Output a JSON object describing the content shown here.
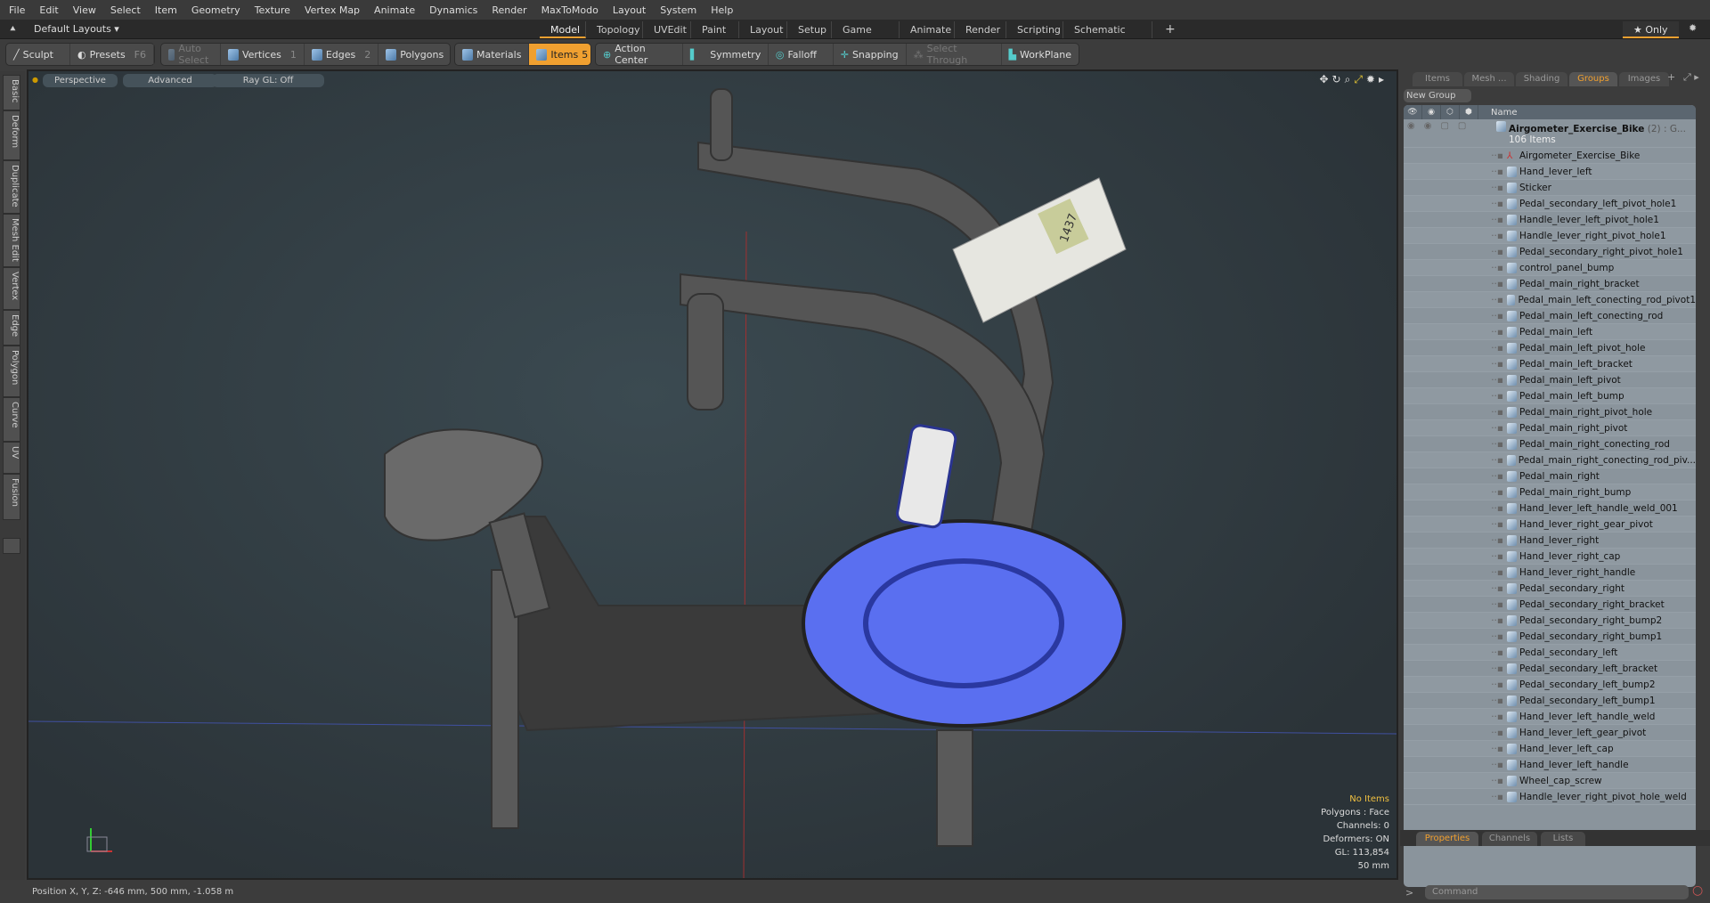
{
  "menu": [
    "File",
    "Edit",
    "View",
    "Select",
    "Item",
    "Geometry",
    "Texture",
    "Vertex Map",
    "Animate",
    "Dynamics",
    "Render",
    "MaxToModo",
    "Layout",
    "System",
    "Help"
  ],
  "layouts": {
    "selector": "Default Layouts ▾",
    "tabs": [
      "Model",
      "Topology",
      "UVEdit",
      "Paint",
      "Layout",
      "Setup",
      "Game Tools",
      "Animate",
      "Render",
      "Scripting",
      "Schematic Fusion"
    ],
    "active": "Model",
    "add": "+",
    "only": "★ Only"
  },
  "toolbar": {
    "sculpt": "Sculpt",
    "presets": "Presets",
    "presets_key": "F6",
    "auto_select": "Auto Select",
    "vertices": "Vertices",
    "vertices_key": "1",
    "edges": "Edges",
    "edges_key": "2",
    "polygons": "Polygons",
    "materials": "Materials",
    "items": "Items",
    "items_key": "5",
    "action_center": "Action Center",
    "symmetry": "Symmetry",
    "falloff": "Falloff",
    "snapping": "Snapping",
    "select_through": "Select Through",
    "workplane": "WorkPlane"
  },
  "left_tabs": [
    "Basic",
    "Deform",
    "Duplicate",
    "Mesh Edit",
    "Vertex",
    "Edge",
    "Polygon",
    "Curve",
    "UV",
    "Fusion"
  ],
  "viewport": {
    "view": "Perspective",
    "shading": "Advanced",
    "raygl": "Ray GL: Off",
    "display_value": "1437",
    "info": {
      "selection": "No Items",
      "mode": "Polygons : Face",
      "channels": "Channels: 0",
      "deformers": "Deformers: ON",
      "gl": "GL: 113,854",
      "scale": "50 mm"
    }
  },
  "status": "Position X, Y, Z:   -646 mm, 500 mm, -1.058 m",
  "right_panel": {
    "tabs": [
      "Items",
      "Mesh ...",
      "Shading",
      "Groups",
      "Images"
    ],
    "active": "Groups",
    "new_group": "New Group",
    "name_header": "Name",
    "group": {
      "name": "Airgometer_Exercise_Bike",
      "suffix": " (2) : G...",
      "count": "106 Items"
    },
    "items": [
      "Airgometer_Exercise_Bike",
      "Hand_lever_left",
      "Sticker",
      "Pedal_secondary_left_pivot_hole1",
      "Handle_lever_left_pivot_hole1",
      "Handle_lever_right_pivot_hole1",
      "Pedal_secondary_right_pivot_hole1",
      "control_panel_bump",
      "Pedal_main_right_bracket",
      "Pedal_main_left_conecting_rod_pivot1",
      "Pedal_main_left_conecting_rod",
      "Pedal_main_left",
      "Pedal_main_left_pivot_hole",
      "Pedal_main_left_bracket",
      "Pedal_main_left_pivot",
      "Pedal_main_left_bump",
      "Pedal_main_right_pivot_hole",
      "Pedal_main_right_pivot",
      "Pedal_main_right_conecting_rod",
      "Pedal_main_right_conecting_rod_piv...",
      "Pedal_main_right",
      "Pedal_main_right_bump",
      "Hand_lever_left_handle_weld_001",
      "Hand_lever_right_gear_pivot",
      "Hand_lever_right",
      "Hand_lever_right_cap",
      "Hand_lever_right_handle",
      "Pedal_secondary_right",
      "Pedal_secondary_right_bracket",
      "Pedal_secondary_right_bump2",
      "Pedal_secondary_right_bump1",
      "Pedal_secondary_left",
      "Pedal_secondary_left_bracket",
      "Pedal_secondary_left_bump2",
      "Pedal_secondary_left_bump1",
      "Hand_lever_left_handle_weld",
      "Hand_lever_left_gear_pivot",
      "Hand_lever_left_cap",
      "Hand_lever_left_handle",
      "Wheel_cap_screw",
      "Handle_lever_right_pivot_hole_weld"
    ],
    "bottom_tabs": [
      "Properties",
      "Channels",
      "Lists"
    ],
    "bottom_active": "Properties",
    "command_placeholder": "Command"
  },
  "colors": {
    "accent": "#f0a030",
    "fan": "#5a6ff0"
  }
}
